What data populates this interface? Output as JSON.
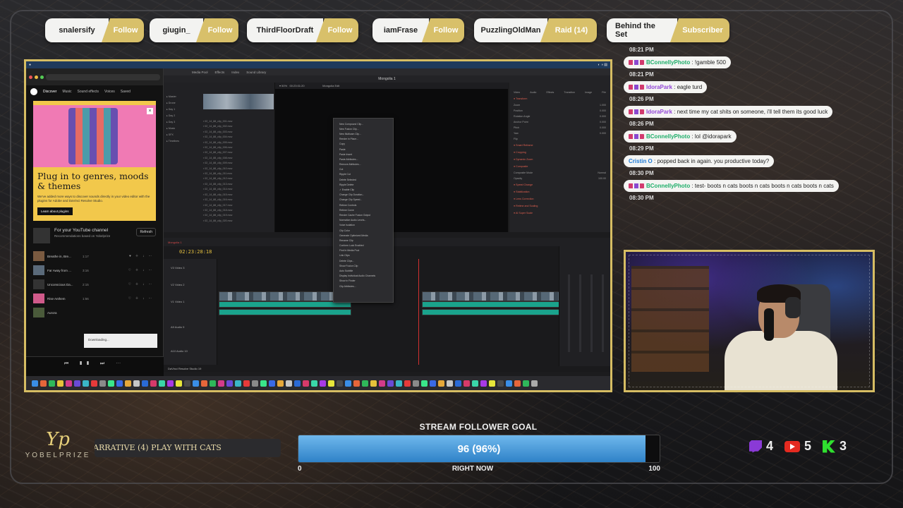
{
  "alerts": [
    {
      "name": "snalersify",
      "action": "Follow"
    },
    {
      "name": "giugin_",
      "action": "Follow"
    },
    {
      "name": "ThirdFloorDraft",
      "action": "Follow"
    },
    {
      "name": "iamFrase",
      "action": "Follow"
    },
    {
      "name": "PuzzlingOldMan",
      "action": "Raid (14)"
    },
    {
      "name": "Behind the Set",
      "action": "Subscriber"
    }
  ],
  "chat": {
    "messages": [
      {
        "time": "08:21 PM",
        "user": "BConnellyPhoto",
        "text": "!gamble 500"
      },
      {
        "time": "08:21 PM",
        "user": "IdoraPark",
        "text": "eagle turd"
      },
      {
        "time": "08:26 PM",
        "user": "IdoraPark",
        "text": "next time my cat shits on someone, i'll tell them its good luck"
      },
      {
        "time": "08:26 PM",
        "user": "BConnellyPhoto",
        "text": "lol @idorapark"
      },
      {
        "time": "08:29 PM",
        "user": "Cristin O",
        "text": "popped back in again. you productive today?"
      },
      {
        "time": "08:30 PM",
        "user": "BConnellyPhoto",
        "text": "test- boots n cats boots n cats boots n cats boots n cats"
      },
      {
        "time": "08:30 PM"
      }
    ]
  },
  "desktop": {
    "browser": {
      "tabs": [
        "Discover",
        "Music",
        "Sound effects",
        "Voices",
        "Saved"
      ],
      "promo_title": "Plug in to genres, moods & themes",
      "promo_body": "We've added more ways to discover sounds directly in your video editor with the plugins for Adobe and DaVinci Resolve Studio.",
      "promo_button": "Learn about plugins",
      "yt_title": "For your YouTube channel",
      "yt_sub": "Recommendations based on Yobelprize",
      "refresh": "Refresh",
      "tracks": [
        {
          "title": "Breathe in, Bre...",
          "time": "1:17"
        },
        {
          "title": "Far Away from ...",
          "time": "3:16"
        },
        {
          "title": "Unconscious Da...",
          "time": "2:15"
        },
        {
          "title": "Rise Anthem",
          "time": "1:56"
        },
        {
          "title": "Aurora",
          "time": ""
        }
      ],
      "toast": "Downloading..."
    },
    "resolve": {
      "title": "Mongolia 1",
      "timecode": "02:23:28:18",
      "footer": "DaVinci Resolve Studio 19"
    }
  },
  "brand": {
    "logo": "Yp",
    "name": "YOBELPRIZE"
  },
  "ticker": "ARRATIVE (4) PLAY WITH CATS",
  "goal": {
    "title": "STREAM FOLLOWER GOAL",
    "value": "96 (96%)",
    "progress": 0.96,
    "min": "0",
    "label": "RIGHT NOW",
    "max": "100"
  },
  "stats": {
    "twitch": "4",
    "youtube": "5",
    "kick": "3"
  },
  "colors": {
    "gold": "#d6bd63",
    "twitch": "#8a3ad6",
    "youtube": "#e52a20",
    "kick": "#2fe02f",
    "goal_fill": "#2f82c8"
  }
}
